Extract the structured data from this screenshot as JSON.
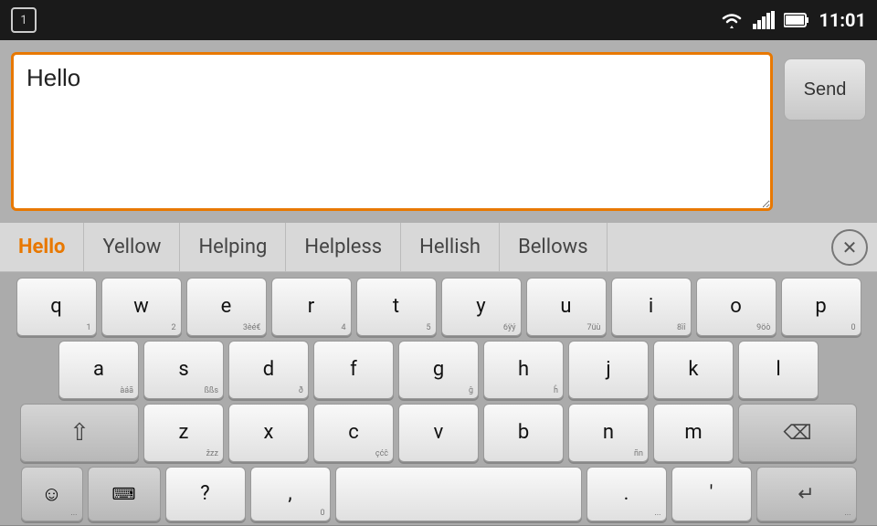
{
  "statusBar": {
    "notificationNum": "1",
    "time": "11:01",
    "wifiIcon": "wifi",
    "signalIcon": "signal",
    "batteryIcon": "battery"
  },
  "inputArea": {
    "textValue": "Hello",
    "sendLabel": "Send"
  },
  "autocomplete": {
    "items": [
      {
        "label": "Hello",
        "selected": true
      },
      {
        "label": "Yellow",
        "selected": false
      },
      {
        "label": "Helping",
        "selected": false
      },
      {
        "label": "Helpless",
        "selected": false
      },
      {
        "label": "Hellish",
        "selected": false
      },
      {
        "label": "Bellows",
        "selected": false
      }
    ],
    "closeLabel": "✕"
  },
  "keyboard": {
    "row1": [
      {
        "main": "q",
        "sub": "1"
      },
      {
        "main": "w",
        "sub": "2"
      },
      {
        "main": "e",
        "sub": "3èé€"
      },
      {
        "main": "r",
        "sub": "4"
      },
      {
        "main": "t",
        "sub": "5"
      },
      {
        "main": "y",
        "sub": "6ÿý"
      },
      {
        "main": "u",
        "sub": "7üù"
      },
      {
        "main": "i",
        "sub": "8ìî"
      },
      {
        "main": "o",
        "sub": "9öò"
      },
      {
        "main": "p",
        "sub": "0"
      }
    ],
    "row2": [
      {
        "main": "a",
        "sub": "àáã"
      },
      {
        "main": "s",
        "sub": "ßßs"
      },
      {
        "main": "d",
        "sub": "ð"
      },
      {
        "main": "f",
        "sub": ""
      },
      {
        "main": "g",
        "sub": "ĝ"
      },
      {
        "main": "h",
        "sub": "ĥ"
      },
      {
        "main": "j",
        "sub": ""
      },
      {
        "main": "k",
        "sub": ""
      },
      {
        "main": "l",
        "sub": ""
      }
    ],
    "row3": [
      {
        "main": "z",
        "sub": "žzz"
      },
      {
        "main": "x",
        "sub": ""
      },
      {
        "main": "c",
        "sub": "çćĉ"
      },
      {
        "main": "v",
        "sub": ""
      },
      {
        "main": "b",
        "sub": ""
      },
      {
        "main": "n",
        "sub": "ñn"
      },
      {
        "main": "m",
        "sub": ""
      }
    ],
    "row4": {
      "question": {
        "main": "?",
        "sub": ""
      },
      "comma": {
        "main": ",",
        "sub": "0"
      },
      "period": {
        "main": ".",
        "sub": "..."
      },
      "apostrophe": {
        "main": "'",
        "sub": ""
      }
    }
  }
}
